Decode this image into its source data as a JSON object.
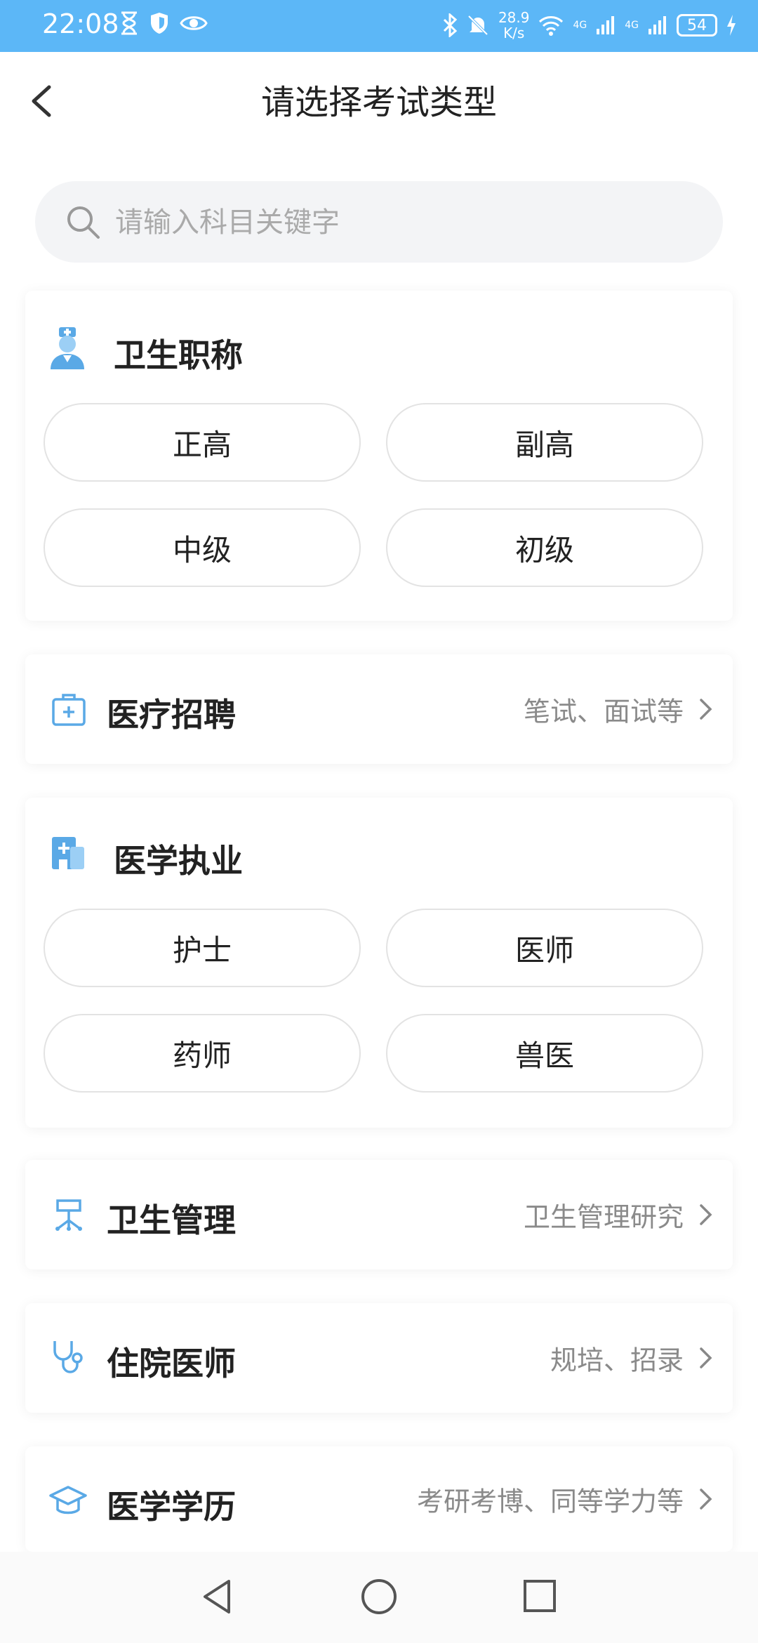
{
  "status_bar": {
    "time": "22:08",
    "speed_value": "28.9",
    "speed_unit": "K/s",
    "signal_label_1": "4G",
    "signal_label_2": "4G",
    "battery": "54"
  },
  "header": {
    "title": "请选择考试类型"
  },
  "search": {
    "placeholder": "请输入科目关键字"
  },
  "sections": {
    "health_title": {
      "title": "卫生职称",
      "options": [
        "正高",
        "副高",
        "中级",
        "初级"
      ]
    },
    "medical_recruit": {
      "title": "医疗招聘",
      "subtitle": "笔试、面试等"
    },
    "medical_practice": {
      "title": "医学执业",
      "options": [
        "护士",
        "医师",
        "药师",
        "兽医"
      ]
    },
    "health_management": {
      "title": "卫生管理",
      "subtitle": "卫生管理研究"
    },
    "resident_physician": {
      "title": "住院医师",
      "subtitle": "规培、招录"
    },
    "medical_education": {
      "title": "医学学历",
      "subtitle": "考研考博、同等学力等"
    }
  },
  "colors": {
    "status_bar": "#5cb7f7",
    "icon_blue": "#5aa9e6"
  }
}
